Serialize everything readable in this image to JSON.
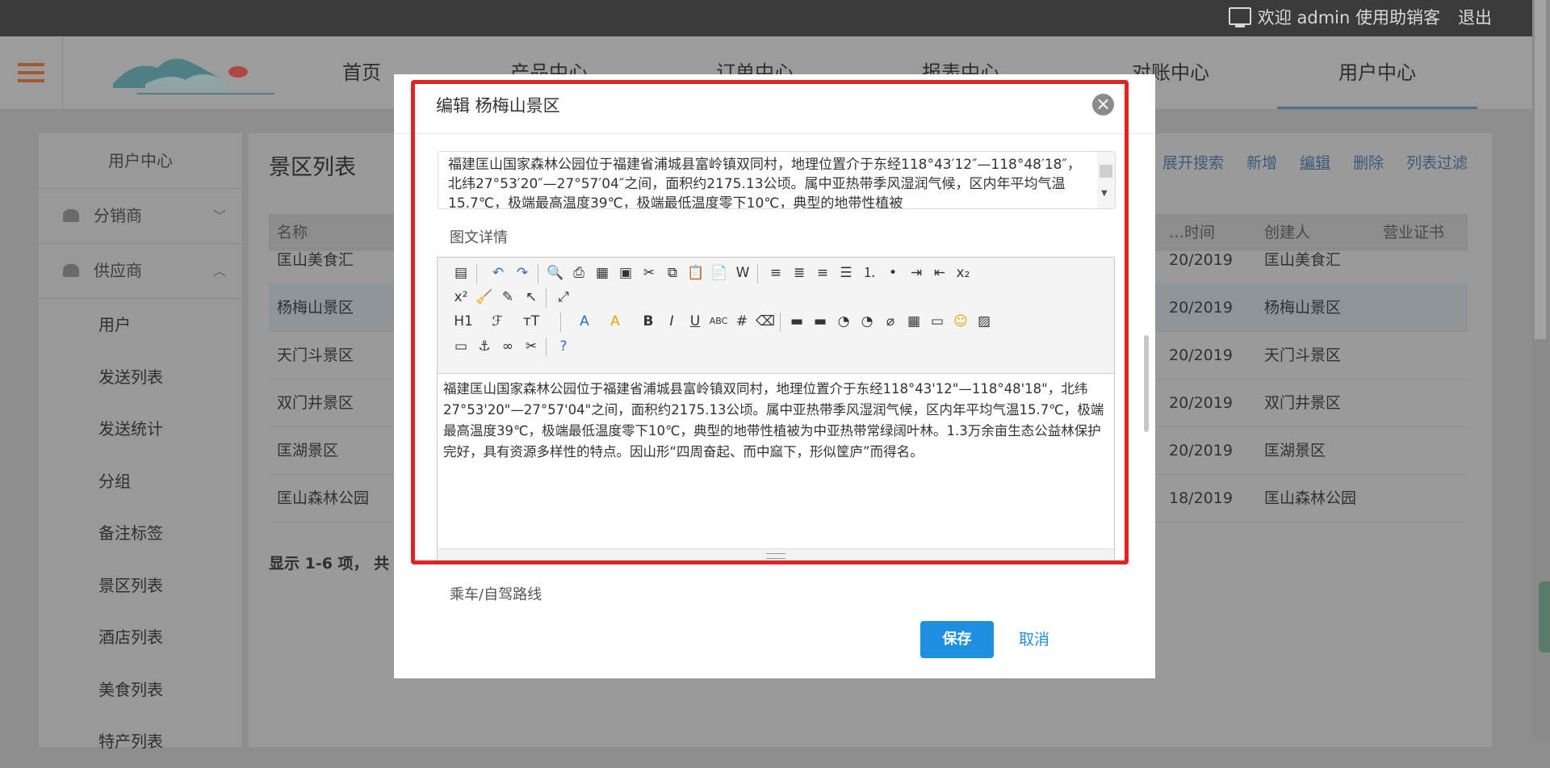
{
  "topbar": {
    "welcome": "欢迎 admin 使用助销客",
    "logout": "退出"
  },
  "nav": {
    "items": [
      "首页",
      "产品中心",
      "订单中心",
      "报表中心",
      "对账中心",
      "用户中心"
    ],
    "active": "用户中心"
  },
  "sidebar": {
    "title": "用户中心",
    "groups": [
      {
        "label": "分销商"
      },
      {
        "label": "供应商"
      }
    ],
    "items": [
      "用户",
      "发送列表",
      "发送统计",
      "分组",
      "备注标签",
      "景区列表",
      "酒店列表",
      "美食列表",
      "特产列表"
    ]
  },
  "main": {
    "title": "景区列表",
    "links": [
      "展开搜索",
      "新增",
      "编辑",
      "删除",
      "列表过滤"
    ],
    "columns": [
      "名称",
      "…时间",
      "创建人",
      "营业证书"
    ],
    "rows": [
      {
        "name": "匡山美食汇",
        "time": "20/2019",
        "creator": "匡山美食汇"
      },
      {
        "name": "杨梅山景区",
        "time": "20/2019",
        "creator": "杨梅山景区"
      },
      {
        "name": "天门斗景区",
        "time": "20/2019",
        "creator": "天门斗景区"
      },
      {
        "name": "双门井景区",
        "time": "20/2019",
        "creator": "双门井景区"
      },
      {
        "name": "匡湖景区",
        "time": "20/2019",
        "creator": "匡湖景区"
      },
      {
        "name": "匡山森林公园",
        "time": "18/2019",
        "creator": "匡山森林公园"
      }
    ],
    "footer": "显示 1-6 项， 共"
  },
  "modal": {
    "title": "编辑 杨梅山景区",
    "intro_text": "福建匡山国家森林公园位于福建省浦城县富岭镇双同村，地理位置介于东经118°43′12″—118°48′18″，北纬27°53′20″—27°57′04″之间，面积约2175.13公顷。属中亚热带季风湿润气候，区内年平均气温15.7℃，极端最高温度39℃，极端最低温度零下10℃，典型的地带性植被",
    "detail_label": "图文详情",
    "editor_text": "福建匡山国家森林公园位于福建省浦城县富岭镇双同村，地理位置介于东经118°43'12\"—118°48'18\"，北纬27°53'20\"—27°57'04\"之间，面积约2175.13公顷。属中亚热带季风湿润气候，区内年平均气温15.7℃，极端最高温度39℃，极端最低温度零下10℃，典型的地带性植被为中亚热带常绿阔叶林。1.3万余亩生态公益林保护完好，具有资源多样性的特点。因山形“四周奋起、而中窳下，形似筐庐”而得名。",
    "route_label": "乘车/自驾路线",
    "save": "保存",
    "cancel": "取消"
  },
  "toolbar_icons": [
    "source",
    "undo",
    "redo",
    "preview",
    "print",
    "template",
    "code",
    "cut",
    "copy",
    "paste",
    "paste-text",
    "paste-word",
    "align-left",
    "align-center",
    "align-right",
    "justify",
    "ordered-list",
    "unordered-list",
    "indent",
    "outdent",
    "subscript",
    "superscript",
    "clear-format",
    "select-all",
    "select",
    "fullscreen",
    "heading",
    "font-family",
    "font-size",
    "font-color",
    "highlight",
    "bold",
    "italic",
    "underline",
    "strikethrough",
    "line-height",
    "eraser",
    "image-insert",
    "flash",
    "media",
    "table",
    "attach",
    "emoticon",
    "picture",
    "hr",
    "anchor",
    "link",
    "unlink",
    "help"
  ],
  "colors": {
    "highlight_frame": "#e02323",
    "primary": "#1e8fe1"
  }
}
